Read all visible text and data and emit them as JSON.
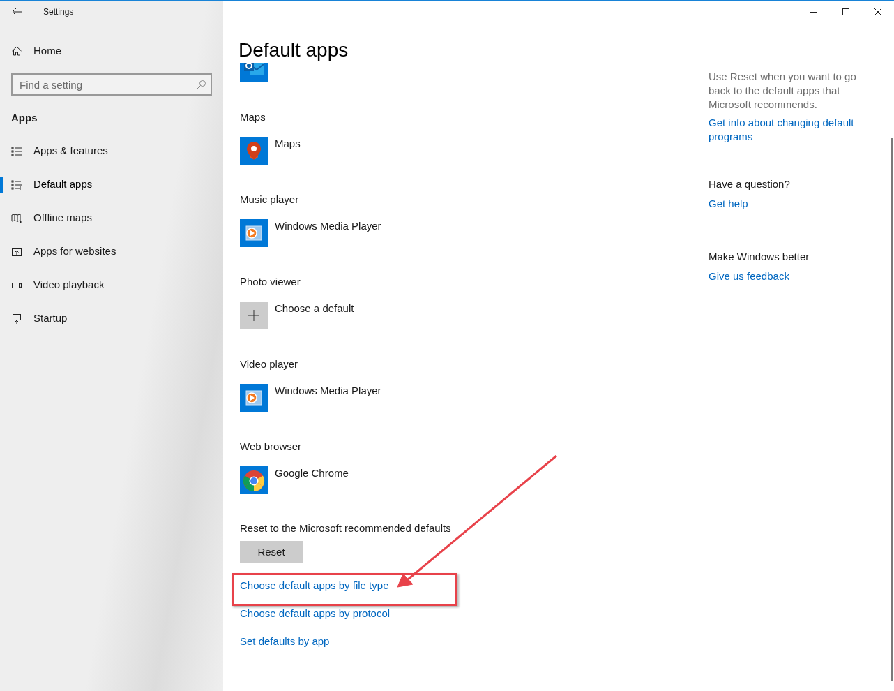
{
  "window": {
    "title": "Settings"
  },
  "sidebar": {
    "home": "Home",
    "search": {
      "placeholder": "Find a setting"
    },
    "section": "Apps",
    "items": [
      {
        "label": "Apps & features",
        "kind": "list",
        "selected": false
      },
      {
        "label": "Default apps",
        "kind": "defaults",
        "selected": true
      },
      {
        "label": "Offline maps",
        "kind": "map",
        "selected": false
      },
      {
        "label": "Apps for websites",
        "kind": "web",
        "selected": false
      },
      {
        "label": "Video playback",
        "kind": "video",
        "selected": false
      },
      {
        "label": "Startup",
        "kind": "startup",
        "selected": false
      }
    ]
  },
  "page": {
    "title": "Default apps",
    "categories": [
      {
        "app": {
          "kind": "outlook"
        }
      },
      {
        "label": "Maps",
        "app": {
          "name": "Maps",
          "kind": "maps"
        }
      },
      {
        "label": "Music player",
        "app": {
          "name": "Windows Media Player",
          "kind": "media"
        }
      },
      {
        "label": "Photo viewer",
        "app": {
          "name": "Choose a default",
          "kind": "add"
        }
      },
      {
        "label": "Video player",
        "app": {
          "name": "Windows Media Player",
          "kind": "media"
        }
      },
      {
        "label": "Web browser",
        "app": {
          "name": "Google Chrome",
          "kind": "chrome"
        }
      }
    ],
    "reset": {
      "label": "Reset to the Microsoft recommended defaults",
      "button": "Reset"
    },
    "links": [
      {
        "text": "Choose default apps by file type",
        "highlighted": true
      },
      {
        "text": "Choose default apps by protocol",
        "highlighted": false
      },
      {
        "text": "Set defaults by app",
        "highlighted": false
      }
    ]
  },
  "aside": {
    "description": "Use Reset when you want to go back to the default apps that Microsoft recommends.",
    "info_link": "Get info about changing default programs",
    "sections": [
      {
        "heading": "Have a question?",
        "link": "Get help"
      },
      {
        "heading": "Make Windows better",
        "link": "Give us feedback"
      }
    ]
  }
}
